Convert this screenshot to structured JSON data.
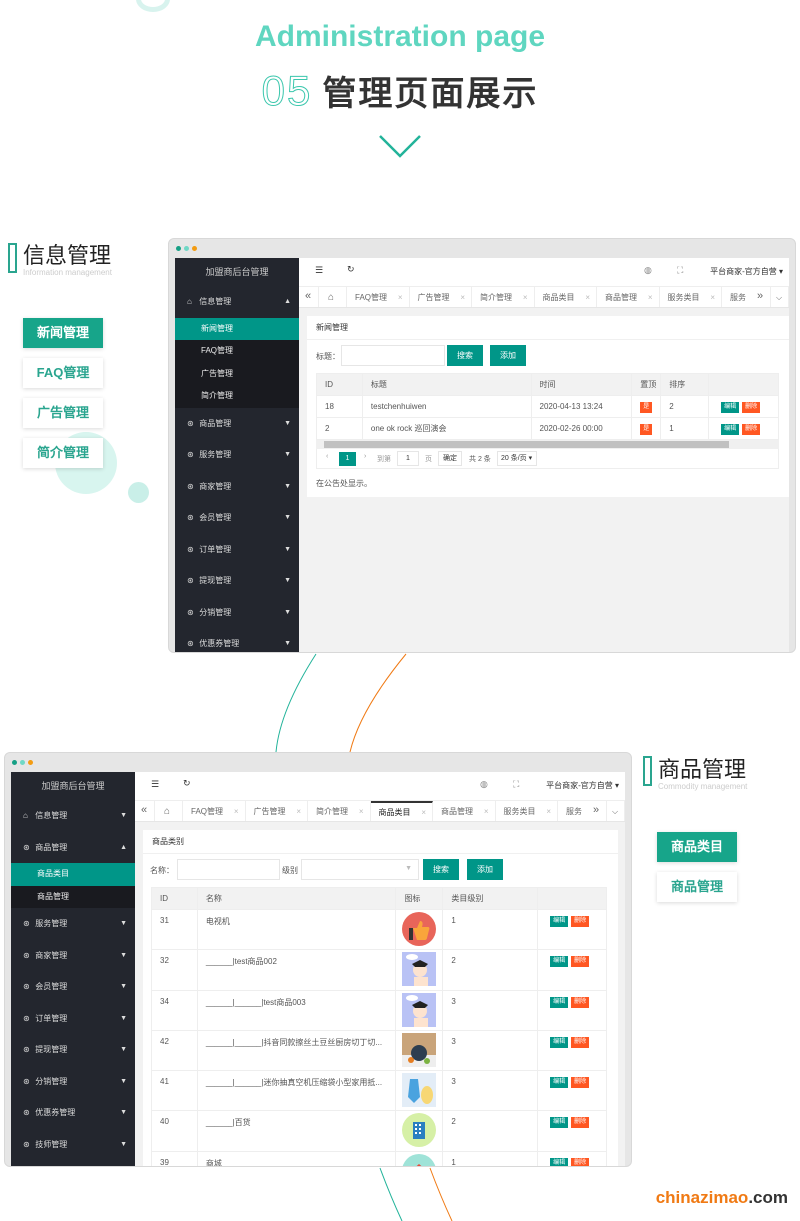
{
  "hero": {
    "title_en": "Administration page",
    "number": "05",
    "title_cn": "管理页面展示"
  },
  "section1": {
    "title": "信息管理",
    "subtitle": "Information management",
    "buttons": [
      "新闻管理",
      "FAQ管理",
      "广告管理",
      "简介管理"
    ],
    "active": 0
  },
  "section2": {
    "title": "商品管理",
    "subtitle": "Commodity management",
    "buttons": [
      "商品类目",
      "商品管理"
    ],
    "active": 0
  },
  "colors": {
    "accent": "#009688",
    "danger": "#ff5722",
    "sidebar": "#23262e",
    "brand": "#f07a14"
  },
  "win1": {
    "sidebar_title": "加盟商后台管理",
    "groups": [
      {
        "label": "信息管理",
        "open": true,
        "icon": "home-icon",
        "items": [
          "新闻管理",
          "FAQ管理",
          "广告管理",
          "简介管理"
        ],
        "active": 0
      },
      {
        "label": "商品管理"
      },
      {
        "label": "服务管理"
      },
      {
        "label": "商家管理"
      },
      {
        "label": "会员管理"
      },
      {
        "label": "订单管理"
      },
      {
        "label": "提现管理"
      },
      {
        "label": "分销管理"
      },
      {
        "label": "优惠券管理"
      }
    ],
    "user": "平台商家-官方自营",
    "tabs": [
      "FAQ管理",
      "广告管理",
      "简介管理",
      "商品类目",
      "商品管理",
      "服务类目",
      "服务"
    ],
    "active_tab": -1,
    "card_title": "新闻管理",
    "search_label": "标题：",
    "search_btn": "搜索",
    "add_btn": "添加",
    "columns": [
      "ID",
      "标题",
      "时间",
      "置顶",
      "排序",
      ""
    ],
    "rows": [
      [
        "18",
        "testchenhuiwen",
        "2020-04-13 13:24",
        "是",
        "2"
      ],
      [
        "2",
        "one ok rock 巡回演会",
        "2020-02-26 00:00",
        "是",
        "1"
      ]
    ],
    "edit": "编辑",
    "delete": "删除",
    "pager": {
      "page": "1",
      "goto": "到第",
      "page_input": "1",
      "page_unit": "页",
      "confirm": "确定",
      "total": "共 2 条",
      "size": "20 条/页"
    },
    "note": "在公告处显示。"
  },
  "win2": {
    "sidebar_title": "加盟商后台管理",
    "groups": [
      {
        "label": "信息管理",
        "icon": "home-icon"
      },
      {
        "label": "商品管理",
        "open": true,
        "items": [
          "商品类目",
          "商品管理"
        ],
        "active": 0
      },
      {
        "label": "服务管理"
      },
      {
        "label": "商家管理"
      },
      {
        "label": "会员管理"
      },
      {
        "label": "订单管理"
      },
      {
        "label": "提现管理"
      },
      {
        "label": "分销管理"
      },
      {
        "label": "优惠券管理"
      },
      {
        "label": "技师管理"
      }
    ],
    "user": "平台商家-官方自营",
    "tabs": [
      "FAQ管理",
      "广告管理",
      "简介管理",
      "商品类目",
      "商品管理",
      "服务类目",
      "服务"
    ],
    "active_tab": 3,
    "card_title": "商品类别",
    "search_label": "名称：",
    "level_label": "级别",
    "search_btn": "搜索",
    "add_btn": "添加",
    "columns": [
      "ID",
      "名称",
      "图标",
      "类目级别",
      ""
    ],
    "rows": [
      [
        "31",
        "电视机",
        "thumbs-up",
        "1"
      ],
      [
        "32",
        "______|test商品002",
        "cartoon-boy",
        "2"
      ],
      [
        "34",
        "______|______|test商品003",
        "cartoon-boy",
        "3"
      ],
      [
        "42",
        "______|______|抖音同款擦丝土豆丝厨房切丁切...",
        "kitchen-tool",
        "3"
      ],
      [
        "41",
        "______|______|迷你抽真空机压缩袋小型家用抵...",
        "vacuum-bag",
        "3"
      ],
      [
        "40",
        "______|百货",
        "building",
        "2"
      ],
      [
        "39",
        "商城",
        "home-up",
        "1"
      ]
    ],
    "edit": "编辑",
    "delete": "删除"
  },
  "footer": {
    "brand": "chinazimao",
    ".com": ".com"
  }
}
